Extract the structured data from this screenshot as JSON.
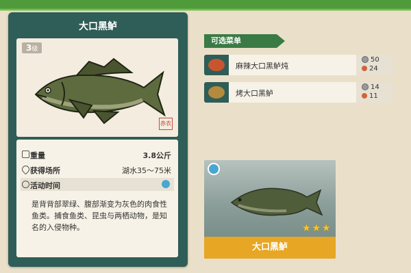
{
  "fish": {
    "name": "大口黑鲈",
    "level": "3",
    "level_suffix": "级",
    "seal": "赤衣"
  },
  "info": {
    "weight_label": "重量",
    "weight_value": "3.8公斤",
    "place_label": "获得场所",
    "place_value": "湖水35～75米",
    "time_label": "活动时间",
    "description": "是背背部翠绿、腹部渐变为灰色的肉食性鱼类。捕食鱼类、昆虫与两栖动物，是知名的入侵物种。"
  },
  "menu": {
    "title": "可选菜单",
    "dishes": [
      {
        "name": "麻辣大口黑鲈炖",
        "coin": "50",
        "energy": "24",
        "plate_color": "#c8552e"
      },
      {
        "name": "烤大口黑鲈",
        "coin": "14",
        "energy": "11",
        "plate_color": "#b58a3c"
      }
    ]
  },
  "photo": {
    "name": "大口黑鲈",
    "stars": "★★★",
    "rating": 3
  },
  "colors": {
    "panel": "#2f5d57",
    "top_bar": "#4f9a3a",
    "menu_tag": "#3a7a45",
    "name_bar": "#e7a623"
  }
}
